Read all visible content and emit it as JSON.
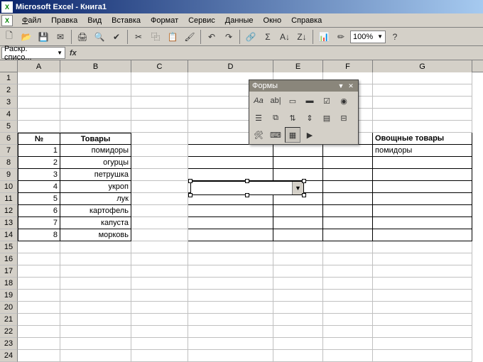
{
  "title": "Microsoft Excel - Книга1",
  "menu": {
    "file": "Файл",
    "edit": "Правка",
    "view": "Вид",
    "insert": "Вставка",
    "format": "Формат",
    "tools": "Сервис",
    "data": "Данные",
    "window": "Окно",
    "help": "Справка"
  },
  "toolbar": {
    "zoom": "100%"
  },
  "namebox": "Раскр. списо...",
  "columns": [
    "A",
    "B",
    "C",
    "D",
    "E",
    "F",
    "G"
  ],
  "rows": [
    "1",
    "2",
    "3",
    "4",
    "5",
    "6",
    "7",
    "8",
    "9",
    "10",
    "11",
    "12",
    "13",
    "14",
    "15",
    "16",
    "17",
    "18",
    "19",
    "20",
    "21",
    "22",
    "23",
    "24"
  ],
  "table": {
    "headers": {
      "num": "№",
      "goods": "Товары"
    },
    "items": [
      {
        "num": "1",
        "goods": "помидоры"
      },
      {
        "num": "2",
        "goods": "огурцы"
      },
      {
        "num": "3",
        "goods": "петрушка"
      },
      {
        "num": "4",
        "goods": "укроп"
      },
      {
        "num": "5",
        "goods": "лук"
      },
      {
        "num": "6",
        "goods": "картофель"
      },
      {
        "num": "7",
        "goods": "капуста"
      },
      {
        "num": "8",
        "goods": "морковь"
      }
    ]
  },
  "side": {
    "header": "Овощные товары",
    "value": "помидоры"
  },
  "forms": {
    "title": "Формы",
    "icons": [
      "label-Aa",
      "textbox-abl",
      "groupbox",
      "button",
      "checkbox",
      "radio",
      "listbox",
      "combobox",
      "scrollbar",
      "spinner",
      "edit",
      "toggle",
      "control-props",
      "code",
      "grid",
      "run"
    ]
  }
}
